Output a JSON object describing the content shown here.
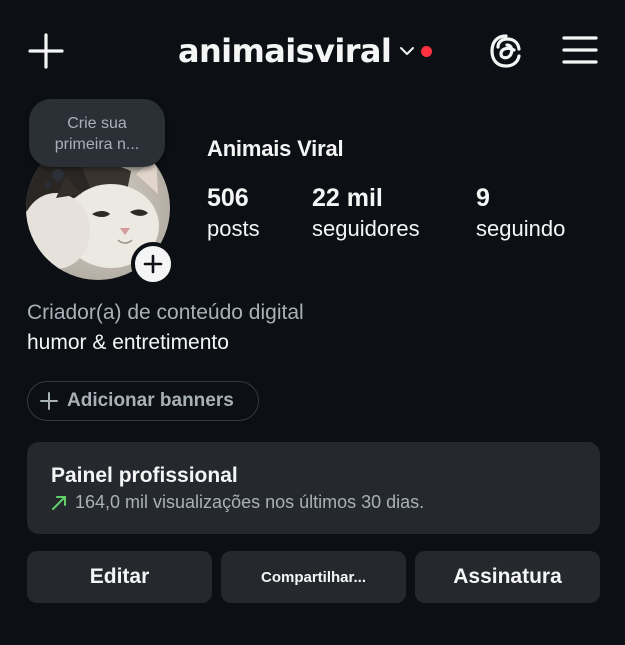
{
  "header": {
    "username": "animaisviral",
    "has_notification_dot": true,
    "icons": {
      "create": "plus-icon",
      "dropdown": "chevron-down-icon",
      "threads": "threads-icon",
      "menu": "hamburger-menu-icon"
    }
  },
  "profile": {
    "note_prompt": "Crie sua primeira n...",
    "display_name": "Animais Viral",
    "avatar_icon": "cat-avatar",
    "add_story_icon": "plus-icon",
    "stats": {
      "posts": {
        "value": "506",
        "label": "posts"
      },
      "followers": {
        "value": "22 mil",
        "label": "seguidores"
      },
      "following": {
        "value": "9",
        "label": "seguindo"
      }
    },
    "category": "Criador(a) de conteúdo digital",
    "bio": "humor & entretimento"
  },
  "banner_button": {
    "label": "Adicionar banners",
    "icon": "plus-icon"
  },
  "professional_panel": {
    "title": "Painel profissional",
    "subtitle": "164,0 mil visualizações nos últimos 30 dias.",
    "trend_icon": "trend-up-arrow-icon"
  },
  "actions": {
    "edit": "Editar",
    "share": "Compartilhar...",
    "subscription": "Assinatura"
  },
  "colors": {
    "background": "#0c1014",
    "surface": "#25292e",
    "secondary_text": "#a8b0b8",
    "notification_dot": "#ff3040",
    "trend_green": "#5fd068"
  }
}
